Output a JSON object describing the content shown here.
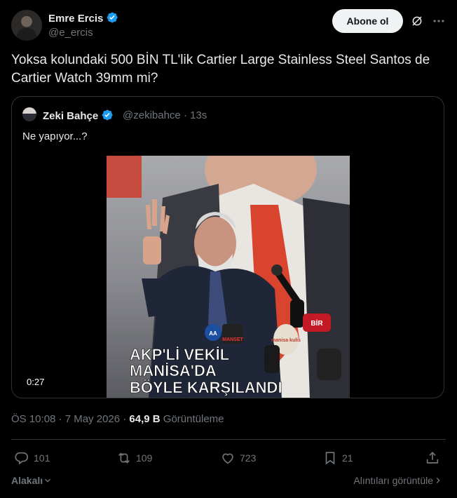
{
  "author": {
    "name": "Emre Ercis",
    "handle": "@e_ercis",
    "follow_label": "Abone ol"
  },
  "tweet": {
    "text": "Yoksa kolundaki 500 BİN TL'lik Cartier Large Stainless Steel Santos de Cartier Watch 39mm mi?"
  },
  "quoted": {
    "name": "Zeki Bahçe",
    "meta": "@zekibahce · 13s",
    "text": "Ne yapıyor...?",
    "video": {
      "duration": "0:27",
      "caption_line1": "AKP'Lİ VEKİL",
      "caption_line2": "MANİSA'DA",
      "caption_line3": "BÖYLE KARŞILANDI",
      "logo_aa": "AA",
      "logo_manset": "MANSET",
      "logo_manisa": "manisa kulis",
      "logo_bbc": "BİR"
    }
  },
  "timestamp": {
    "time_date": "ÖS 10:08 · 7 May 2026 · ",
    "views_count": "64,9 B",
    "views_label": " Görüntüleme"
  },
  "actions": {
    "replies": "101",
    "reposts": "109",
    "likes": "723",
    "bookmarks": "21"
  },
  "footer": {
    "relevance_label": "Alakalı",
    "view_quotes_label": "Alıntıları görüntüle"
  },
  "colors": {
    "background": "#000000",
    "text_primary": "#e7e9ea",
    "text_secondary": "#71767b",
    "border": "#2f3336",
    "verified_blue": "#1d9bf0",
    "follow_button_bg": "#eff3f4"
  }
}
